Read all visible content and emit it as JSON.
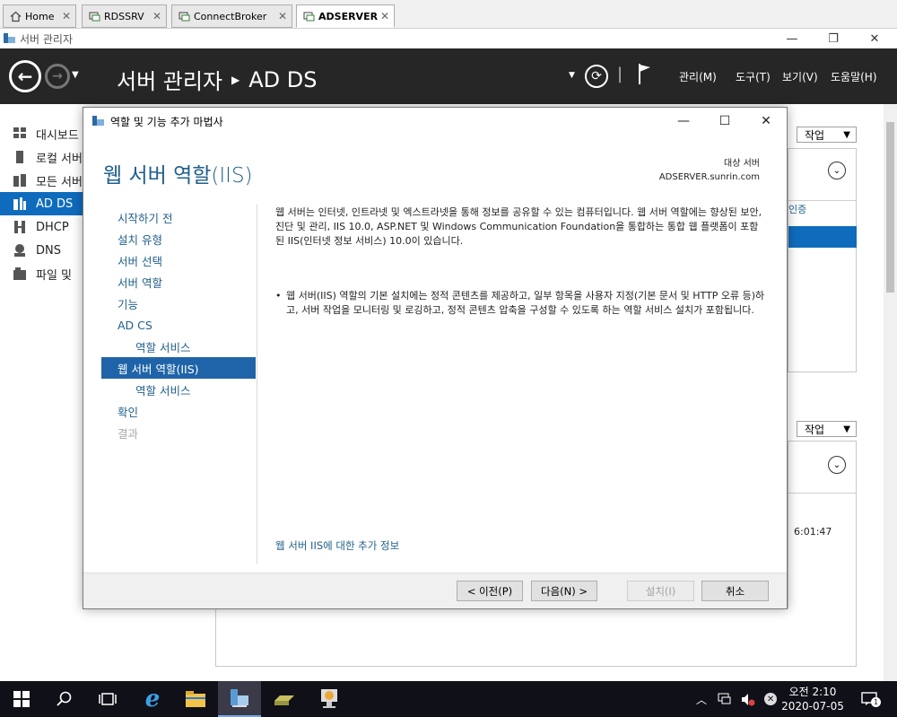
{
  "tabs": [
    {
      "label": "Home",
      "icon": "home-icon"
    },
    {
      "label": "RDSSRV",
      "icon": "remote-desktop-icon"
    },
    {
      "label": "ConnectBroker",
      "icon": "remote-desktop-icon"
    },
    {
      "label": "ADSERVER",
      "icon": "remote-desktop-icon"
    }
  ],
  "app": {
    "title": "서버 관리자",
    "breadcrumb_root": "서버 관리자",
    "breadcrumb_current": "AD DS",
    "menu": [
      "관리(M)",
      "도구(T)",
      "보기(V)",
      "도움말(H)"
    ]
  },
  "nav": {
    "items": [
      {
        "label": "대시보드",
        "icon": "dashboard-icon"
      },
      {
        "label": "로컬 서버",
        "icon": "local-server-icon"
      },
      {
        "label": "모든 서버",
        "icon": "all-servers-icon"
      },
      {
        "label": "AD DS",
        "icon": "ad-ds-icon"
      },
      {
        "label": "DHCP",
        "icon": "dhcp-icon"
      },
      {
        "label": "DNS",
        "icon": "dns-icon"
      },
      {
        "label": "파일 및",
        "icon": "file-services-icon"
      }
    ]
  },
  "background": {
    "task_button_1": "작업",
    "task_button_2": "작업",
    "auth_fragment": "인증",
    "time_fragment": "6:01:47"
  },
  "wizard": {
    "title": "역할 및 기능 추가 마법사",
    "heading": "웹 서버 역할(IIS)",
    "target_label": "대상 서버",
    "target_server": "ADSERVER.sunrin.com",
    "steps": [
      {
        "label": "시작하기 전",
        "state": "normal"
      },
      {
        "label": "설치 유형",
        "state": "normal"
      },
      {
        "label": "서버 선택",
        "state": "normal"
      },
      {
        "label": "서버 역할",
        "state": "normal"
      },
      {
        "label": "기능",
        "state": "normal"
      },
      {
        "label": "AD CS",
        "state": "normal"
      },
      {
        "label": "역할 서비스",
        "state": "sub"
      },
      {
        "label": "웹 서버 역할(IIS)",
        "state": "active"
      },
      {
        "label": "역할 서비스",
        "state": "sub"
      },
      {
        "label": "확인",
        "state": "normal"
      },
      {
        "label": "결과",
        "state": "disabled"
      }
    ],
    "intro": "웹 서버는 인터넷, 인트라넷 및 엑스트라넷을 통해 정보를 공유할 수 있는 컴퓨터입니다. 웹 서버 역할에는 향상된 보안, 진단 및 관리, IIS 10.0, ASP.NET 및 Windows Communication Foundation을 통합하는 통합 웹 플랫폼이 포함된 IIS(인터넷 정보 서비스) 10.0이 있습니다.",
    "bullet": "웹 서버(IIS) 역할의 기본 설치에는 정적 콘텐츠를 제공하고, 일부 항목을 사용자 지정(기본 문서 및 HTTP 오류 등)하고, 서버 작업을 모니터링 및 로깅하고, 정적 콘텐츠 압축을 구성할 수 있도록 하는 역할 서비스 설치가 포함됩니다.",
    "more_info_link": "웹 서버 IIS에 대한 추가 정보",
    "buttons": {
      "prev": "< 이전(P)",
      "next": "다음(N) >",
      "install": "설치(I)",
      "cancel": "취소"
    }
  },
  "taskbar": {
    "clock_time": "오전 2:10",
    "clock_date": "2020-07-05",
    "notification_count": "1"
  }
}
